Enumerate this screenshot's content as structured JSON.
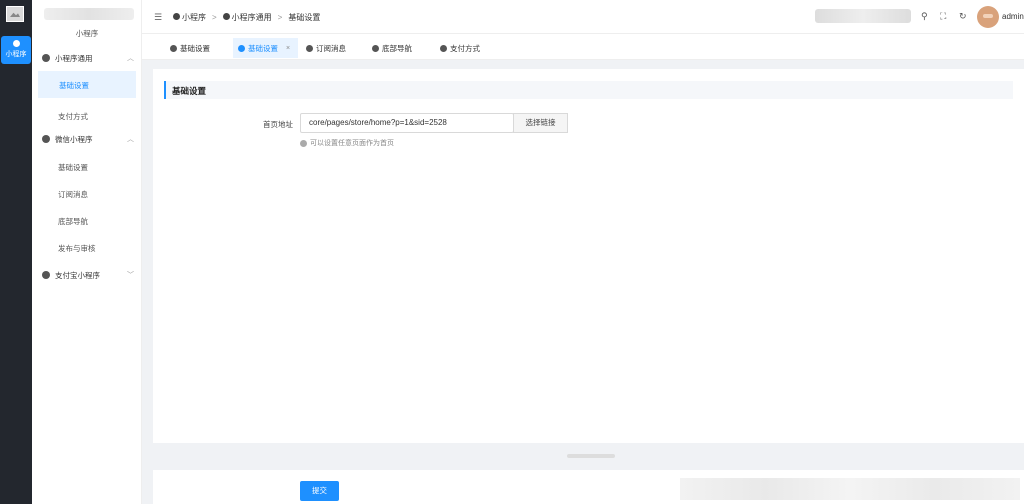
{
  "rail": {
    "active_label": "小程序"
  },
  "sidebar": {
    "app_name": "小程序",
    "groups": [
      {
        "label": "小程序通用",
        "items": [
          "基础设置",
          "支付方式"
        ]
      },
      {
        "label": "微信小程序",
        "items": [
          "基础设置",
          "订阅消息",
          "底部导航",
          "发布与审核"
        ]
      },
      {
        "label": "支付宝小程序",
        "items": []
      }
    ]
  },
  "header": {
    "breadcrumb": [
      "小程序",
      "小程序通用",
      "基础设置"
    ],
    "username": "admin"
  },
  "tabs": [
    {
      "label": "基础设置",
      "active": false
    },
    {
      "label": "基础设置",
      "active": true
    },
    {
      "label": "订阅消息",
      "active": false
    },
    {
      "label": "底部导航",
      "active": false
    },
    {
      "label": "支付方式",
      "active": false
    }
  ],
  "form": {
    "section_title": "基础设置",
    "homepage_label": "首页地址",
    "homepage_value": "core/pages/store/home?p=1&sid=2528",
    "select_link_label": "选择链接",
    "hint": "可以设置任意页面作为首页",
    "submit_label": "提交"
  },
  "colors": {
    "accent": "#1e90ff",
    "rail_bg": "#23272e"
  },
  "icons": {
    "menu": "menu-fold-icon",
    "search": "search-icon",
    "fullscreen": "fullscreen-icon",
    "refresh": "refresh-icon"
  }
}
